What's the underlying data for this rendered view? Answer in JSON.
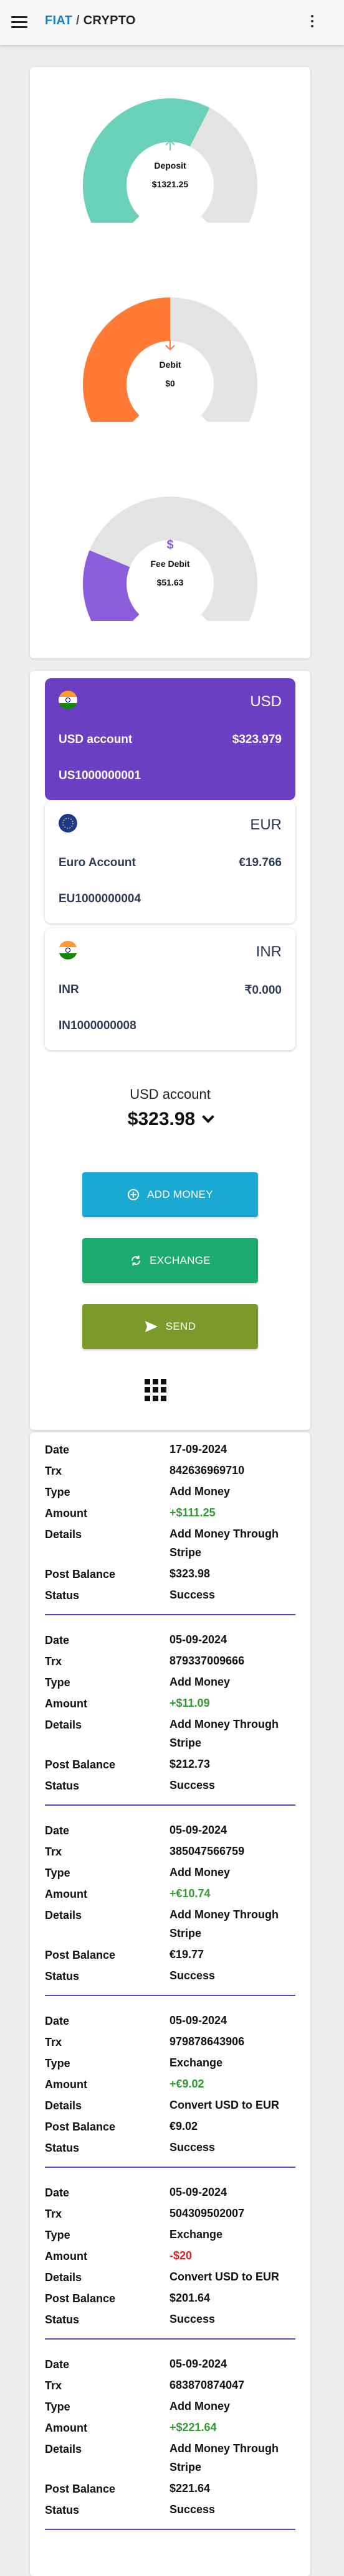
{
  "header": {
    "brand_part1": "FIAT",
    "brand_sep": " / ",
    "brand_part2": "CRYPTO"
  },
  "gauges": [
    {
      "label": "Deposit",
      "value": "$1321.25",
      "fill_fraction": 0.6,
      "color": "#6ad1b8",
      "icon": "arrow-up-icon"
    },
    {
      "label": "Debit",
      "value": "$0",
      "fill_fraction": 0.5,
      "color": "#ff7b35",
      "icon": "arrow-down-icon"
    },
    {
      "label": "Fee Debit",
      "value": "$51.63",
      "fill_fraction": 0.25,
      "color": "#8b5cdc",
      "icon": "dollar-icon"
    }
  ],
  "accounts": [
    {
      "currency": "USD",
      "name": "USD account",
      "balance": "$323.979",
      "number": "US1000000001",
      "flag": "india-flag-icon",
      "active": true
    },
    {
      "currency": "EUR",
      "name": "Euro Account",
      "balance": "€19.766",
      "number": "EU1000000004",
      "flag": "eu-flag-icon",
      "active": false
    },
    {
      "currency": "INR",
      "name": "INR",
      "balance": "₹0.000",
      "number": "IN1000000008",
      "flag": "india-flag-icon",
      "active": false
    }
  ],
  "selector": {
    "label": "USD account",
    "value": "$323.98"
  },
  "actions": {
    "add_money": "ADD MONEY",
    "exchange": "EXCHANGE",
    "send": "SEND"
  },
  "colors": {
    "add_money": "#1aa9d2",
    "exchange": "#1cab6e",
    "send": "#7c9a2a",
    "accent": "#6a3fc2"
  },
  "tx_labels": {
    "date": "Date",
    "trx": "Trx",
    "type": "Type",
    "amount": "Amount",
    "details": "Details",
    "post_balance": "Post Balance",
    "status": "Status"
  },
  "transactions": [
    {
      "date": "17-09-2024",
      "trx": "842636969710",
      "type": "Add Money",
      "amount": "+$111.25",
      "details": "Add Money Through Stripe",
      "post_balance": "$323.98",
      "status": "Success"
    },
    {
      "date": "05-09-2024",
      "trx": "879337009666",
      "type": "Add Money",
      "amount": "+$11.09",
      "details": "Add Money Through Stripe",
      "post_balance": "$212.73",
      "status": "Success"
    },
    {
      "date": "05-09-2024",
      "trx": "385047566759",
      "type": "Add Money",
      "amount": "+€10.74",
      "details": "Add Money Through Stripe",
      "post_balance": "€19.77",
      "status": "Success"
    },
    {
      "date": "05-09-2024",
      "trx": "979878643906",
      "type": "Exchange",
      "amount": "+€9.02",
      "details": "Convert USD to EUR",
      "post_balance": "€9.02",
      "status": "Success"
    },
    {
      "date": "05-09-2024",
      "trx": "504309502007",
      "type": "Exchange",
      "amount": "-$20",
      "details": "Convert USD to EUR",
      "post_balance": "$201.64",
      "status": "Success"
    },
    {
      "date": "05-09-2024",
      "trx": "683870874047",
      "type": "Add Money",
      "amount": "+$221.64",
      "details": "Add Money Through Stripe",
      "post_balance": "$221.64",
      "status": "Success"
    }
  ]
}
